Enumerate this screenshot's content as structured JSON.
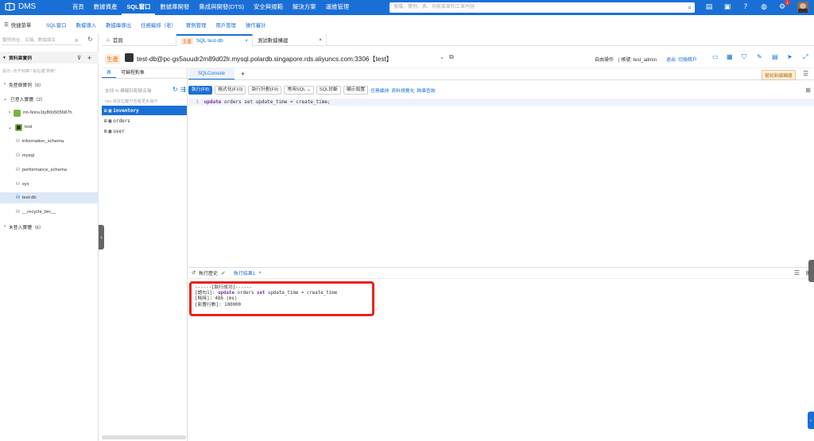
{
  "brand": {
    "name": "DMS"
  },
  "topnav": [
    "首頁",
    "數據資產",
    "SQL窗口",
    "數據庫開發",
    "集成與開發(DTS)",
    "安全與規範",
    "解決方案",
    "運維管理"
  ],
  "search": {
    "placeholder": "搜羅、實例、表、功能菜單和工單內容"
  },
  "notification_count": "1",
  "quickbar": {
    "label": "快捷菜單",
    "links": [
      "SQL窗口",
      "數據導入",
      "數據庫導出",
      "任務編排（老）",
      "實例管理",
      "用戶管理",
      "操作審計"
    ]
  },
  "leftpane": {
    "search_placeholder": "實例地址、名稱、數據庫名",
    "section": "資料庫實例",
    "hint": "提示: 找不到庫? 點右鍵\"刷新\"",
    "rows": [
      {
        "label": "免登錄實例（0）"
      },
      {
        "label": "已登入實體（2）"
      },
      {
        "label": "rm-6nnu1ty80n505687h"
      },
      {
        "label": "test"
      },
      {
        "label": "information_schema"
      },
      {
        "label": "mysql"
      },
      {
        "label": "performance_schema"
      },
      {
        "label": "sys"
      },
      {
        "label": "test-db"
      },
      {
        "label": "__recycle_bin__"
      },
      {
        "label": "未登入實體（6）"
      }
    ]
  },
  "tabs": [
    {
      "label": "首頁"
    },
    {
      "badge": "生產",
      "label": "SQL test-db"
    },
    {
      "label": "測試數據構建"
    }
  ],
  "conn": {
    "env": "生產",
    "host": "test-db@pc-gs5auudr2m89d02lr.mysql.polardb.singapore.rds.aliyuncs.com:3306【test】",
    "mode": "自由操作",
    "account_label": "| 帳號: test_admin",
    "logout": "退出",
    "switch": "切換賬戶",
    "try_new": "嘗試新編輯器"
  },
  "sidepanel": {
    "tabs": [
      "表",
      "可編程對象"
    ],
    "search": "支持 % 模糊匹配錶名稱",
    "tip": "tips:滑鼠右鍵可查看更多操作",
    "tables": [
      "inventory",
      "orders",
      "user"
    ]
  },
  "editor": {
    "tab": "SQLConsole",
    "buttons": [
      "執行(F8)",
      "格式化(F10)",
      "執行計劃(F9)",
      "常用SQL",
      "SQL診斷",
      "顯示設置"
    ],
    "links": [
      "任務編排",
      "資料視覺化",
      "跨庫查詢"
    ],
    "line_no": "1",
    "code_kw1": "update",
    "code_rest": "orders set update_time = create_time;"
  },
  "results": {
    "history": "執行歷史",
    "result_tab": "執行結果1",
    "line1": "------[執行成功]------",
    "line2_prefix": "[語句1]:",
    "line2_kw": "update",
    "line2_mid": "orders",
    "line2_kw2": "set",
    "line2_end": "update_time = create_time",
    "line3": "[耗時]: 486 (ms)",
    "line4": "[影響行數]: 100000"
  }
}
